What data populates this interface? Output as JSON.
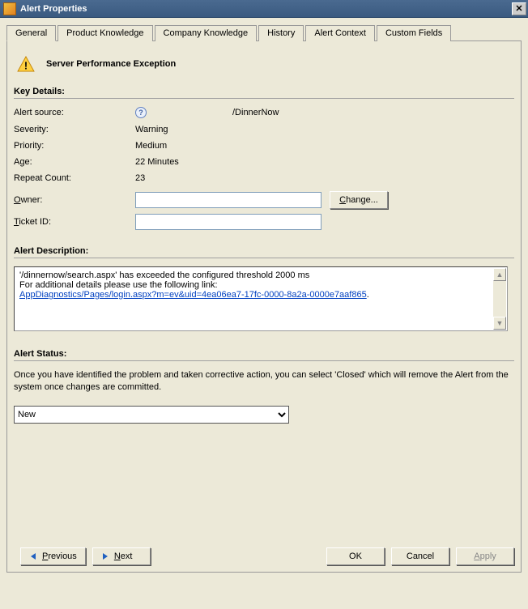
{
  "window": {
    "title": "Alert Properties"
  },
  "tabs": [
    {
      "label": "General",
      "active": true
    },
    {
      "label": "Product Knowledge",
      "active": false
    },
    {
      "label": "Company Knowledge",
      "active": false
    },
    {
      "label": "History",
      "active": false
    },
    {
      "label": "Alert Context",
      "active": false
    },
    {
      "label": "Custom Fields",
      "active": false
    }
  ],
  "alert": {
    "title": "Server Performance Exception"
  },
  "sections": {
    "key_details_heading": "Key Details:",
    "alert_description_heading": "Alert Description:",
    "alert_status_heading": "Alert Status:"
  },
  "details": {
    "alert_source": {
      "label": "Alert source:",
      "value": "/DinnerNow"
    },
    "severity": {
      "label": "Severity:",
      "value": "Warning"
    },
    "priority": {
      "label": "Priority:",
      "value": "Medium"
    },
    "age": {
      "label": "Age:",
      "value": "22 Minutes"
    },
    "repeat_count": {
      "label": "Repeat Count:",
      "value": "23"
    },
    "owner": {
      "label": "Owner:",
      "value": ""
    },
    "ticket_id": {
      "label": "Ticket ID:",
      "value": ""
    }
  },
  "buttons": {
    "change": "Change...",
    "previous": "Previous",
    "next": "Next",
    "ok": "OK",
    "cancel": "Cancel",
    "apply": "Apply"
  },
  "description": {
    "line1": "'/dinnernow/search.aspx' has exceeded the configured threshold 2000 ms",
    "line2": "For additional details please use the following link:",
    "link_text": "AppDiagnostics/Pages/login.aspx?m=ev&uid=4ea06ea7-17fc-0000-8a2a-0000e7aaf865"
  },
  "status": {
    "help_text": "Once you have identified the problem and taken corrective action, you can select 'Closed' which will remove the Alert from the system once changes are committed.",
    "selected": "New"
  }
}
